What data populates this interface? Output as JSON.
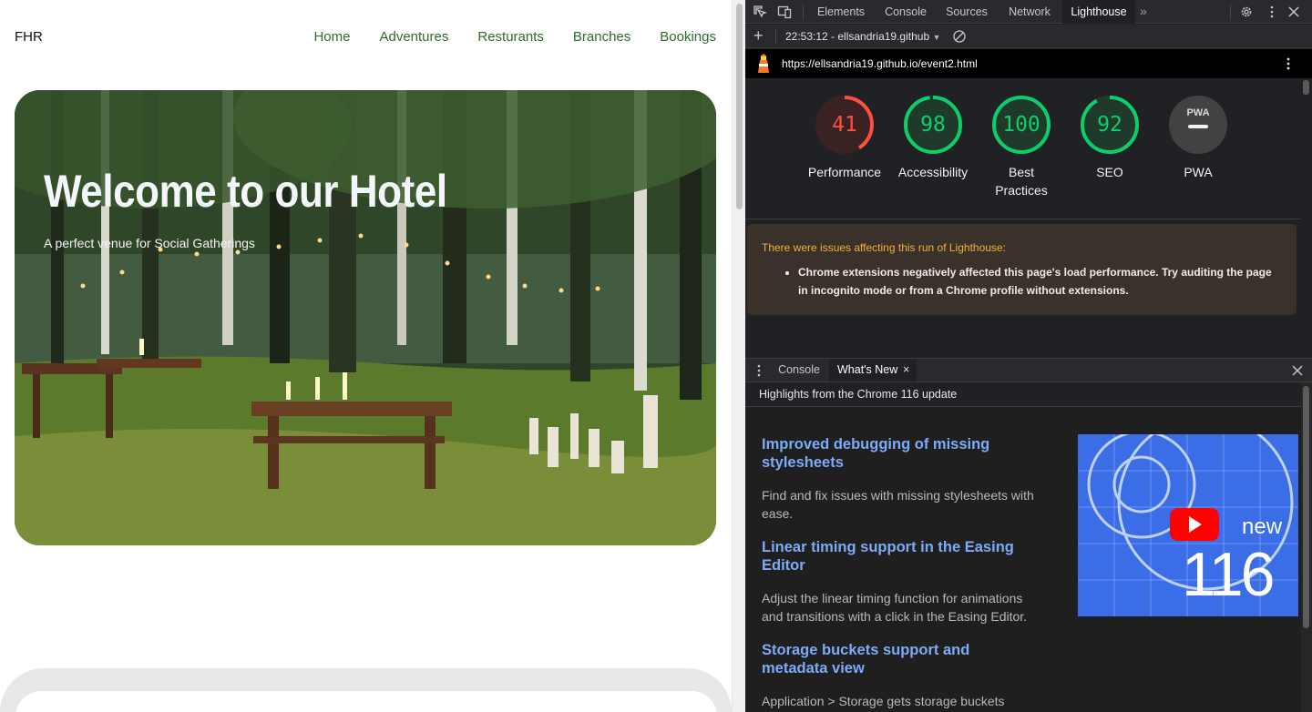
{
  "site": {
    "brand": "FHR",
    "nav": [
      "Home",
      "Adventures",
      "Resturants",
      "Branches",
      "Bookings"
    ],
    "hero": {
      "title": "Welcome to our Hotel",
      "subtitle": "A perfect venue for Social Gatherings"
    }
  },
  "devtools": {
    "tabs": [
      "Elements",
      "Console",
      "Sources",
      "Network",
      "Lighthouse"
    ],
    "active_tab": "Lighthouse",
    "report_selector": "22:53:12 - ellsandria19.github",
    "url": "https://ellsandria19.github.io/event2.html",
    "scores": [
      {
        "label": "Performance",
        "value": "41",
        "score": 41,
        "color": "#ff4e42"
      },
      {
        "label": "Accessibility",
        "value": "98",
        "score": 98,
        "color": "#0cce6b"
      },
      {
        "label": "Best Practices",
        "value": "100",
        "score": 100,
        "color": "#0cce6b"
      },
      {
        "label": "SEO",
        "value": "92",
        "score": 92,
        "color": "#0cce6b"
      },
      {
        "label": "PWA",
        "value": "",
        "score": null,
        "color": "#9e9e9e"
      }
    ],
    "pwa_badge": "PWA",
    "warning": {
      "title": "There were issues affecting this run of Lighthouse:",
      "items": [
        "Chrome extensions negatively affected this page's load performance. Try auditing the page in incognito mode or from a Chrome profile without extensions."
      ]
    },
    "drawer": {
      "tabs": [
        "Console",
        "What's New"
      ],
      "active_tab": "What's New",
      "heading": "Highlights from the Chrome 116 update",
      "items": [
        {
          "title": "Improved debugging of missing stylesheets",
          "desc": "Find and fix issues with missing stylesheets with ease."
        },
        {
          "title": "Linear timing support in the Easing Editor",
          "desc": "Adjust the linear timing function for animations and transitions with a click in the Easing Editor."
        },
        {
          "title": "Storage buckets support and metadata view",
          "desc": "Application > Storage gets storage buckets"
        }
      ],
      "promo": {
        "word": "new",
        "number": "116"
      }
    }
  }
}
